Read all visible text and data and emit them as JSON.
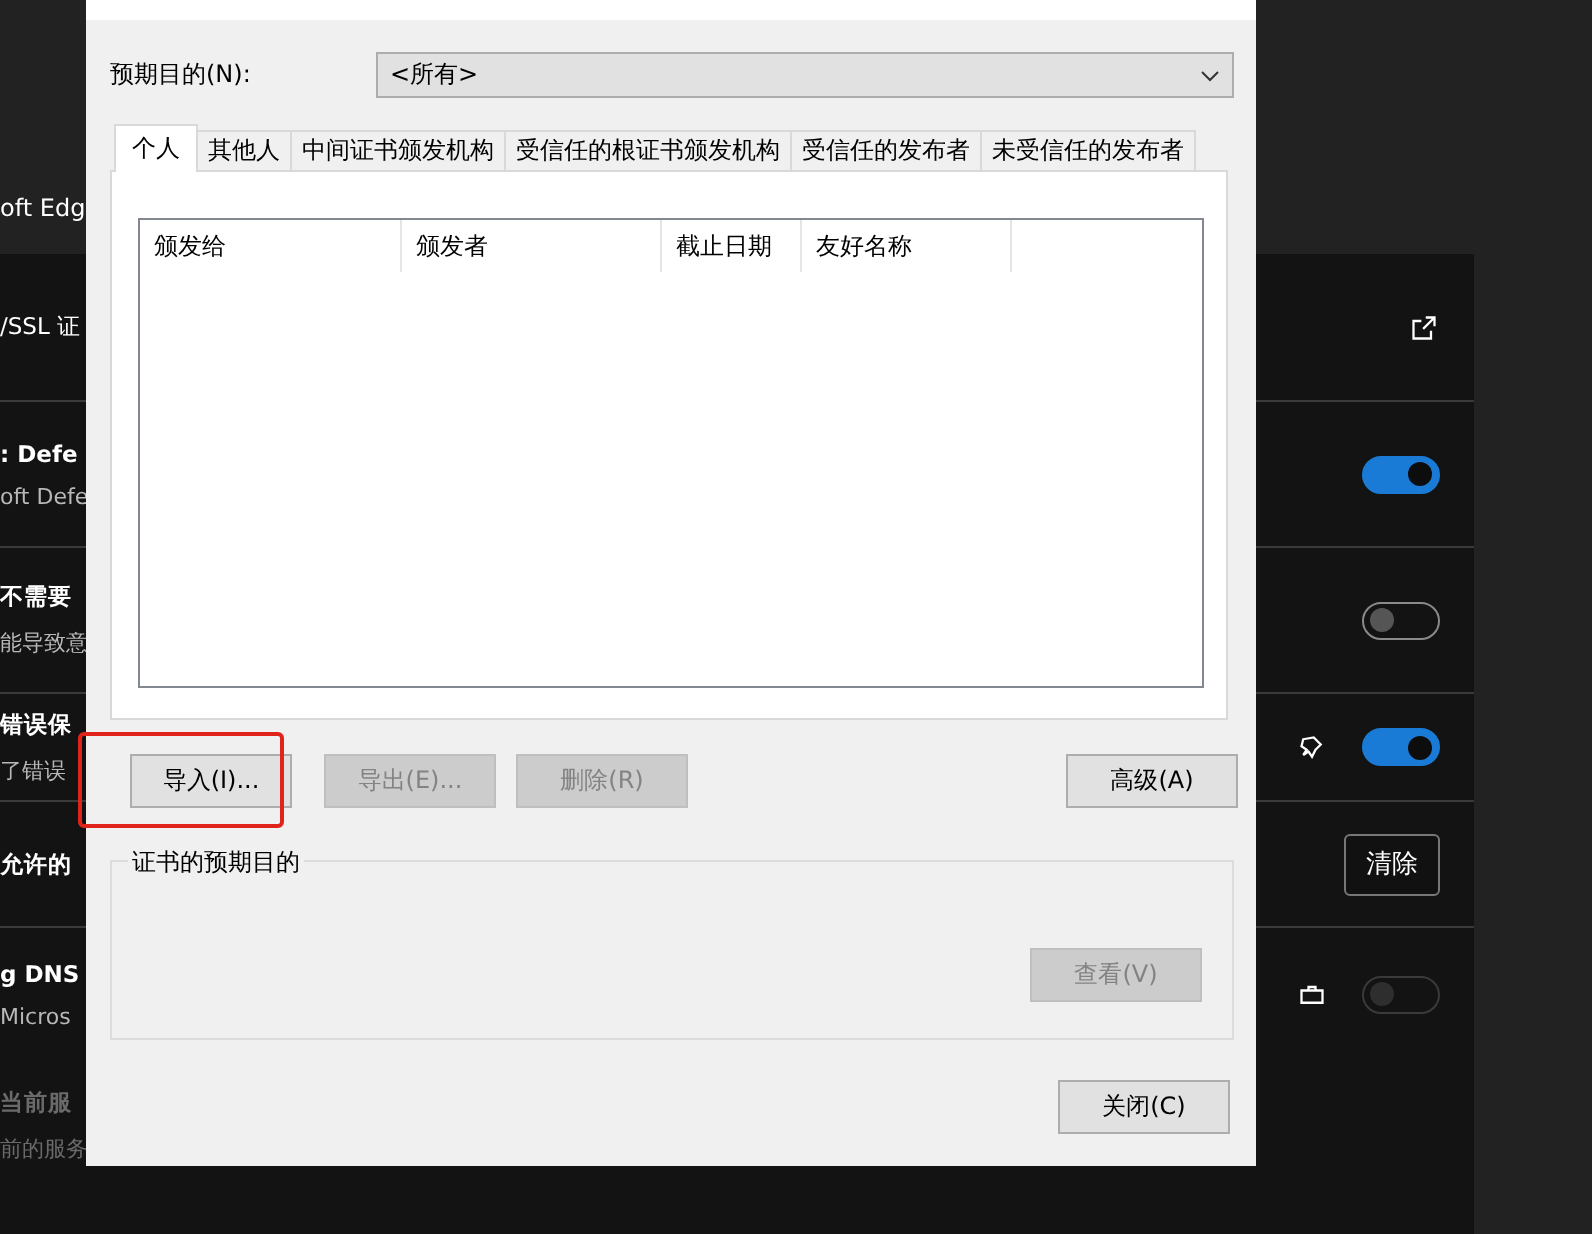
{
  "background_settings": {
    "heading_fragment": "oft Edg",
    "rows": [
      {
        "kind": "link",
        "title": "/SSL 证",
        "title_bold": false
      },
      {
        "kind": "toggle",
        "title": ": Defe",
        "title_bold": true,
        "subtitle": "oft Defe",
        "on": true,
        "disabled": false
      },
      {
        "kind": "toggle",
        "title": "不需要",
        "title_bold": true,
        "subtitle": "能导致意",
        "on": false,
        "disabled": false
      },
      {
        "kind": "pinned-toggle",
        "title": "错误保",
        "title_bold": true,
        "subtitle": "了错误",
        "on": true,
        "disabled": false
      },
      {
        "kind": "button",
        "title": "允许的",
        "title_bold": true,
        "button_label": "清除"
      },
      {
        "kind": "locked-toggle",
        "title": "g DNS",
        "title_bold": true,
        "subtitle": "Micros",
        "on": false,
        "disabled": true
      },
      {
        "kind": "plain",
        "title": "当前服",
        "title_bold": true,
        "subtitle": "前的服务",
        "dimmed": true
      }
    ]
  },
  "dialog": {
    "purpose": {
      "label": "预期目的(N):",
      "value": "<所有>"
    },
    "tabs": [
      {
        "label": "个人",
        "selected": true
      },
      {
        "label": "其他人",
        "selected": false
      },
      {
        "label": "中间证书颁发机构",
        "selected": false
      },
      {
        "label": "受信任的根证书颁发机构",
        "selected": false
      },
      {
        "label": "受信任的发布者",
        "selected": false
      },
      {
        "label": "未受信任的发布者",
        "selected": false
      }
    ],
    "table": {
      "columns": [
        "颁发给",
        "颁发者",
        "截止日期",
        "友好名称"
      ]
    },
    "buttons": [
      {
        "label": "导入(I)...",
        "disabled": false,
        "highlighted": true
      },
      {
        "label": "导出(E)...",
        "disabled": true,
        "highlighted": false
      },
      {
        "label": "删除(R)",
        "disabled": true,
        "highlighted": false
      }
    ],
    "advanced_button": {
      "label": "高级(A)",
      "disabled": false
    },
    "purpose_group": {
      "title": "证书的预期目的",
      "view_button": {
        "label": "查看(V)",
        "disabled": true
      }
    },
    "close_button": {
      "label": "关闭(C)",
      "disabled": false
    }
  }
}
